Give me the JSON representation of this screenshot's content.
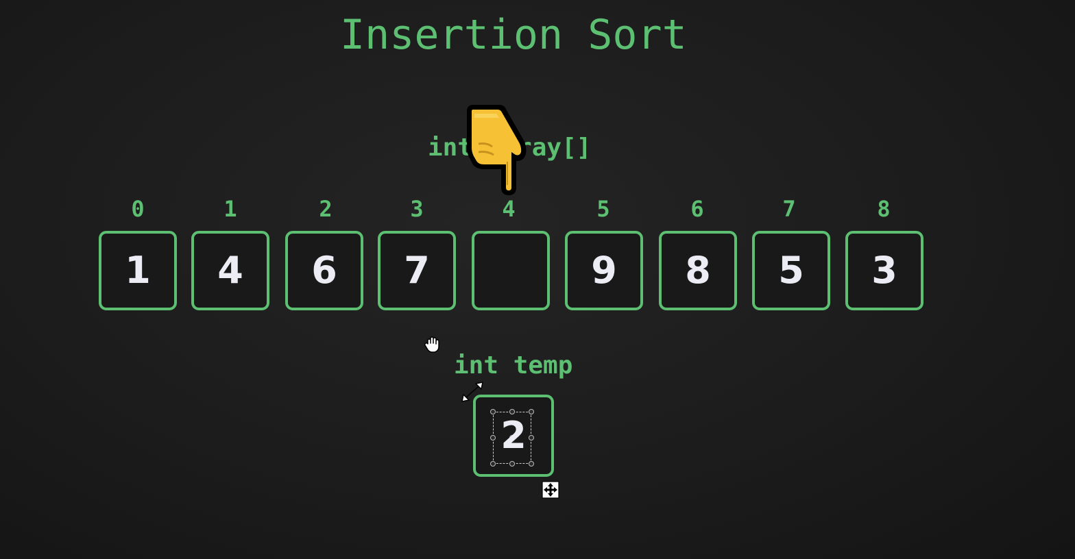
{
  "title": "Insertion Sort",
  "array": {
    "label": "int array[]",
    "indices": [
      "0",
      "1",
      "2",
      "3",
      "4",
      "5",
      "6",
      "7",
      "8"
    ],
    "values": [
      "1",
      "4",
      "6",
      "7",
      "",
      "9",
      "8",
      "5",
      "3"
    ]
  },
  "temp": {
    "label": "int temp",
    "value": "2"
  },
  "colors": {
    "accent": "#5cbf72",
    "background": "#1c1c1c",
    "value_text": "#ececf4"
  },
  "icons": {
    "pointer": "pointing-down-hand-icon",
    "grab": "grab-hand-cursor-icon",
    "resize": "diagonal-resize-cursor-icon",
    "move": "move-cursor-icon"
  }
}
